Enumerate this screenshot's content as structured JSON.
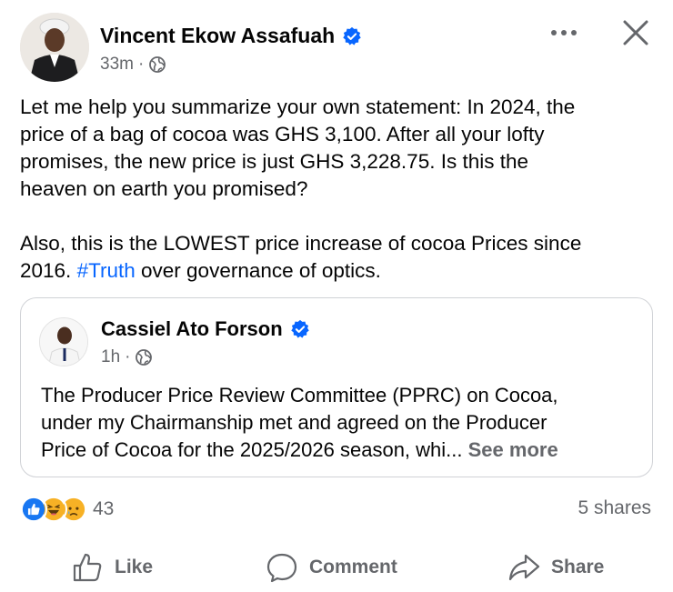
{
  "post": {
    "author": "Vincent Ekow Assafuah",
    "time": "33m",
    "separator": "·",
    "text_p1": "Let me help you summarize your own statement: In 2024, the\nprice of a bag of cocoa was GHS 3,100. After all your lofty\npromises, the new price is just GHS 3,228.75. Is this the\nheaven on earth you promised?",
    "text_p2_before": "Also, this is the LOWEST price increase of cocoa Prices since\n2016.  ",
    "hashtag": "#Truth",
    "text_p2_after": " over governance of optics."
  },
  "shared": {
    "author": "Cassiel Ato Forson",
    "time": "1h",
    "separator": "·",
    "text": "The Producer Price Review Committee (PPRC) on Cocoa,\nunder my Chairmanship met and agreed on the Producer\nPrice of Cocoa for the 2025/2026 season, whi... ",
    "see_more": "See more"
  },
  "engagement": {
    "reaction_count": "43",
    "shares": "5 shares",
    "reaction_icons": [
      "like-icon",
      "haha-icon",
      "sad-icon"
    ]
  },
  "actions": {
    "like": "Like",
    "comment": "Comment",
    "share": "Share"
  },
  "colors": {
    "verified_blue": "#0866ff",
    "hashtag_blue": "#0866ff",
    "secondary_text": "#65676b"
  }
}
